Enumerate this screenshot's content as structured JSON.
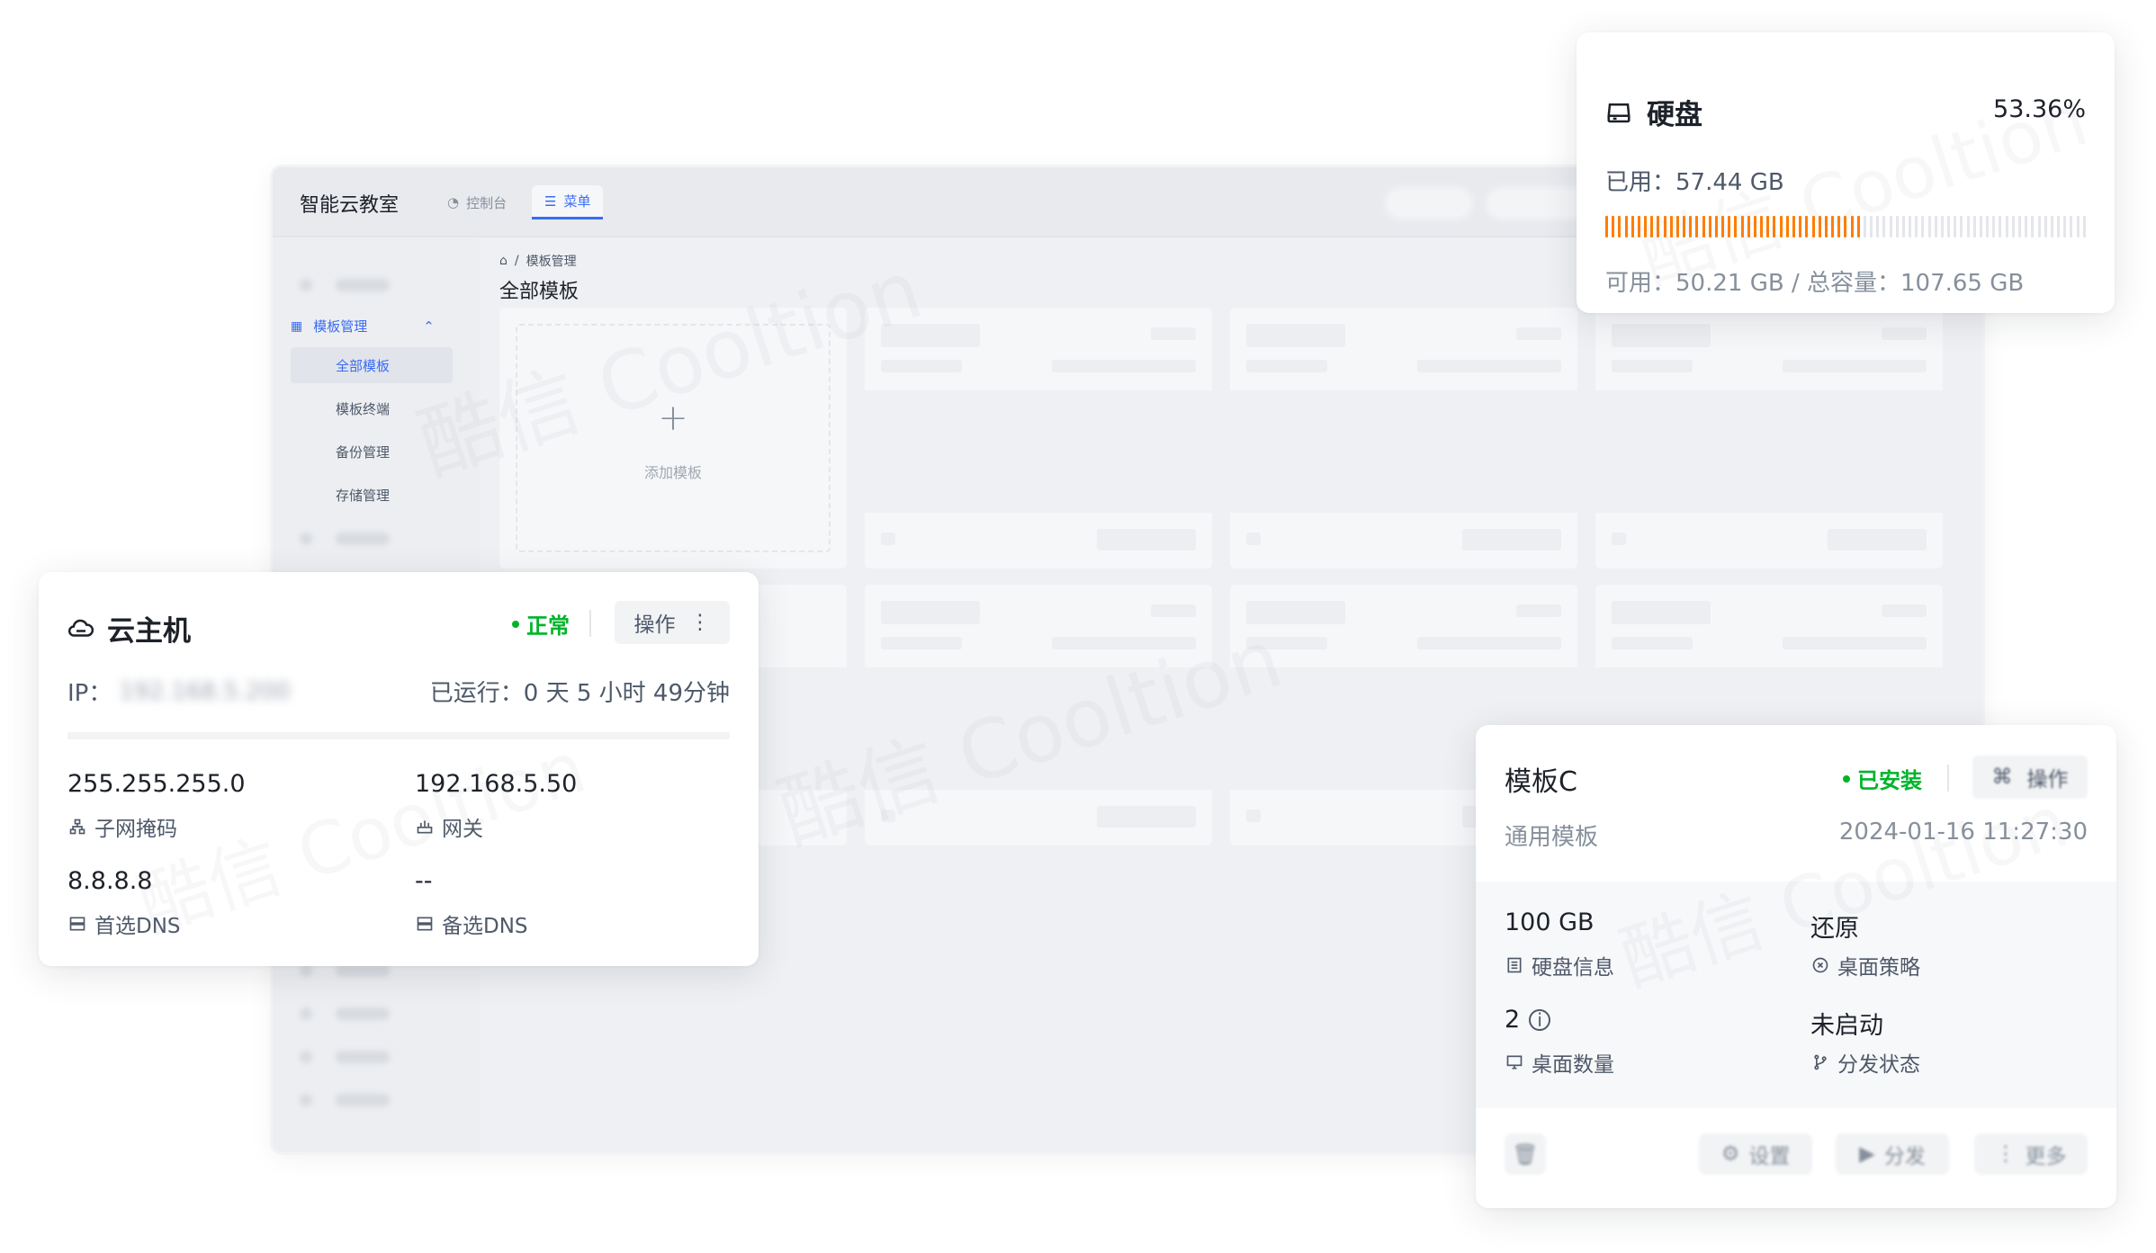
{
  "app": {
    "brand": "智能云教室",
    "tabs": [
      {
        "label": "控制台",
        "icon": "dashboard-icon"
      },
      {
        "label": "菜单",
        "icon": "menu-icon"
      }
    ],
    "sidebar": {
      "group_label": "模板管理",
      "sub_items": [
        "全部模板",
        "模板终端",
        "备份管理",
        "存储管理"
      ]
    },
    "breadcrumb": "模板管理",
    "page_title": "全部模板",
    "add_template_label": "添加模板",
    "watermark": "酷信 Cooltion"
  },
  "disk": {
    "title": "硬盘",
    "percent": "53.36%",
    "used_label": "已用：",
    "used_value": "57.44 GB",
    "avail_label": "可用：",
    "avail_value": "50.21 GB",
    "total_sep": "/ 总容量：",
    "total_value": "107.65 GB",
    "usage_fraction": 0.5336,
    "colors": {
      "used": "#ff7d00",
      "free": "#e5e6eb"
    }
  },
  "host": {
    "title": "云主机",
    "status": "正常",
    "op_label": "操作",
    "ip_label": "IP：",
    "ip_value": "192.168.5.200",
    "runtime_label": "已运行：",
    "runtime_value": "0 天 5 小时 49分钟",
    "fields": [
      {
        "value": "255.255.255.0",
        "label": "子网掩码",
        "icon": "subnet-icon"
      },
      {
        "value": "192.168.5.50",
        "label": "网关",
        "icon": "gateway-icon"
      },
      {
        "value": "8.8.8.8",
        "label": "首选DNS",
        "icon": "server-icon"
      },
      {
        "value": "--",
        "label": "备选DNS",
        "icon": "server-icon"
      }
    ]
  },
  "template": {
    "title": "模板C",
    "status": "已安装",
    "op_label": "操作",
    "subtitle": "通用模板",
    "date": "2024-01-16 11:27:30",
    "fields": [
      {
        "value": "100 GB",
        "label": "硬盘信息",
        "icon": "disk-info-icon"
      },
      {
        "value": "还原",
        "label": "桌面策略",
        "icon": "policy-icon"
      },
      {
        "value": "2",
        "label": "桌面数量",
        "icon": "monitor-icon"
      },
      {
        "value": "未启动",
        "label": "分发状态",
        "icon": "branch-icon"
      }
    ],
    "footer": {
      "settings": "设置",
      "distribute": "分发",
      "more": "更多"
    }
  },
  "colors": {
    "accent": "#3a6cf4",
    "success": "#00b42a",
    "warning": "#ff7d00"
  }
}
